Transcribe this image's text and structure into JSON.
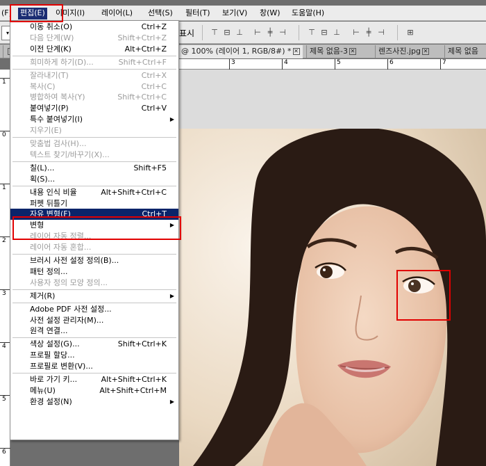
{
  "menubar": {
    "items": [
      {
        "label": "(F)"
      },
      {
        "label": "편집(E)"
      },
      {
        "label": "이미지(I)"
      },
      {
        "label": "레이어(L)"
      },
      {
        "label": "선택(S)"
      },
      {
        "label": "필터(T)"
      },
      {
        "label": "보기(V)"
      },
      {
        "label": "창(W)"
      },
      {
        "label": "도움말(H)"
      }
    ]
  },
  "options_bar": {
    "combo_glyph": "▾",
    "show_label": "표시",
    "icons": [
      "align-top-icon",
      "align-vcenter-icon",
      "align-bottom-icon",
      "align-left-icon",
      "align-hcenter-icon",
      "align-right-icon",
      "distribute-top-icon",
      "distribute-vcenter-icon",
      "distribute-bottom-icon",
      "distribute-left-icon",
      "distribute-hcenter-icon",
      "distribute-right-icon",
      "auto-align-icon"
    ]
  },
  "tabs": [
    {
      "label": "@ 100% (레이어 1, RGB/8#) *"
    },
    {
      "label": "제목 없음-3"
    },
    {
      "label": "렌즈사진.jpg"
    },
    {
      "label": "제목 없음"
    }
  ],
  "tab_close_glyph": "✕",
  "ruler": {
    "top_ticks": [
      "3",
      "4",
      "5",
      "6",
      "7"
    ],
    "left_ticks": [
      "1",
      "0",
      "1",
      "2",
      "3",
      "4",
      "5",
      "6"
    ]
  },
  "edit_menu": {
    "items": [
      {
        "label": "이동 취소(O)",
        "shortcut": "Ctrl+Z",
        "disabled": false
      },
      {
        "label": "다음 단계(W)",
        "shortcut": "Shift+Ctrl+Z",
        "disabled": true
      },
      {
        "label": "이전 단계(K)",
        "shortcut": "Alt+Ctrl+Z",
        "disabled": false
      },
      {
        "separator": true
      },
      {
        "label": "희미하게 하기(D)...",
        "shortcut": "Shift+Ctrl+F",
        "disabled": true
      },
      {
        "separator": true
      },
      {
        "label": "잘라내기(T)",
        "shortcut": "Ctrl+X",
        "disabled": true
      },
      {
        "label": "복사(C)",
        "shortcut": "Ctrl+C",
        "disabled": true
      },
      {
        "label": "병합하여 복사(Y)",
        "shortcut": "Shift+Ctrl+C",
        "disabled": true
      },
      {
        "label": "붙여넣기(P)",
        "shortcut": "Ctrl+V",
        "disabled": false
      },
      {
        "label": "특수 붙여넣기(I)",
        "shortcut": "",
        "disabled": false,
        "submenu": true
      },
      {
        "label": "지우기(E)",
        "shortcut": "",
        "disabled": true
      },
      {
        "separator": true
      },
      {
        "label": "맞춤법 검사(H)...",
        "shortcut": "",
        "disabled": true
      },
      {
        "label": "텍스트 찾기/바꾸기(X)...",
        "shortcut": "",
        "disabled": true
      },
      {
        "separator": true
      },
      {
        "label": "칠(L)...",
        "shortcut": "Shift+F5",
        "disabled": false
      },
      {
        "label": "획(S)...",
        "shortcut": "",
        "disabled": false
      },
      {
        "separator": true
      },
      {
        "label": "내용 인식 비율",
        "shortcut": "Alt+Shift+Ctrl+C",
        "disabled": false
      },
      {
        "label": "퍼펫 뒤틀기",
        "shortcut": "",
        "disabled": false
      },
      {
        "label": "자유 변형(F)",
        "shortcut": "Ctrl+T",
        "disabled": false,
        "highlighted": true
      },
      {
        "label": "변형",
        "shortcut": "",
        "disabled": false,
        "submenu": true
      },
      {
        "label": "레이어 자동 정렬...",
        "shortcut": "",
        "disabled": true
      },
      {
        "label": "레이어 자동 혼합...",
        "shortcut": "",
        "disabled": true
      },
      {
        "separator": true
      },
      {
        "label": "브러시 사전 설정 정의(B)...",
        "shortcut": "",
        "disabled": false
      },
      {
        "label": "패턴 정의...",
        "shortcut": "",
        "disabled": false
      },
      {
        "label": "사용자 정의 모양 정의...",
        "shortcut": "",
        "disabled": true
      },
      {
        "separator": true
      },
      {
        "label": "제거(R)",
        "shortcut": "",
        "disabled": false,
        "submenu": true
      },
      {
        "separator": true
      },
      {
        "label": "Adobe PDF 사전 설정...",
        "shortcut": "",
        "disabled": false
      },
      {
        "label": "사전 설정 관리자(M)...",
        "shortcut": "",
        "disabled": false
      },
      {
        "label": "원격 연결...",
        "shortcut": "",
        "disabled": false
      },
      {
        "separator": true
      },
      {
        "label": "색상 설정(G)...",
        "shortcut": "Shift+Ctrl+K",
        "disabled": false
      },
      {
        "label": "프로필 할당...",
        "shortcut": "",
        "disabled": false
      },
      {
        "label": "프로필로 변환(V)...",
        "shortcut": "",
        "disabled": false
      },
      {
        "separator": true
      },
      {
        "label": "바로 가기 키...",
        "shortcut": "Alt+Shift+Ctrl+K",
        "disabled": false
      },
      {
        "label": "메뉴(U)",
        "shortcut": "Alt+Shift+Ctrl+M",
        "disabled": false
      },
      {
        "label": "환경 설정(N)",
        "shortcut": "",
        "disabled": false,
        "submenu": true
      }
    ],
    "submenu_glyph": "▶"
  },
  "colors": {
    "highlight": "#0a246a",
    "annotation": "#e10000",
    "menubar_active": "#1b2d73"
  }
}
